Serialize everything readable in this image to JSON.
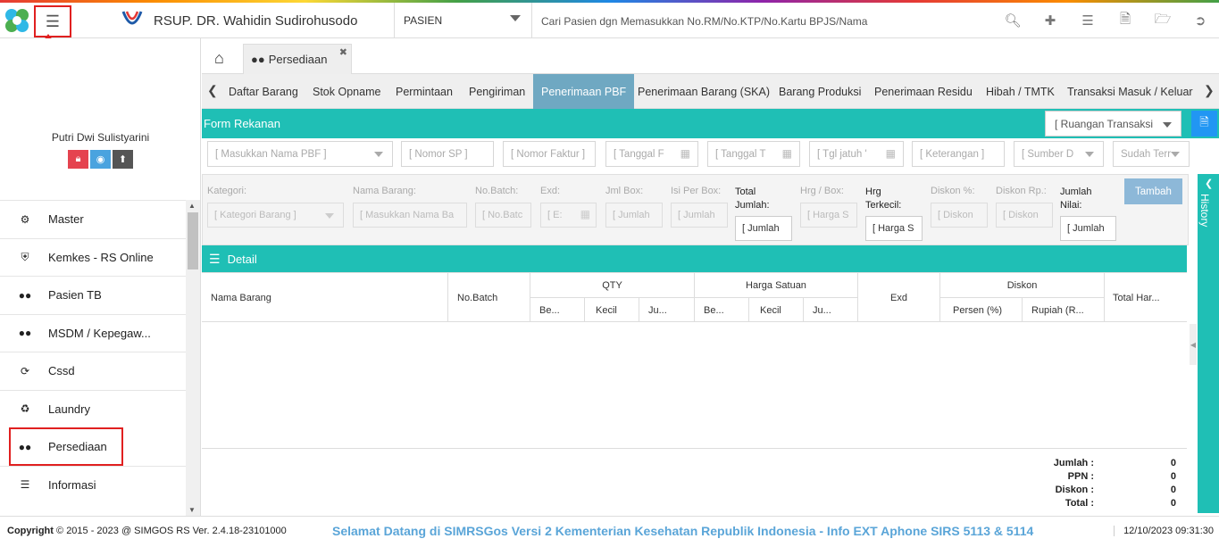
{
  "header": {
    "hospital_name": "RSUP. DR. Wahidin Sudirohusodo",
    "patient_select": "PASIEN",
    "search_placeholder": "Cari Pasien dgn Memasukkan No.RM/No.KTP/No.Kartu BPJS/Nama",
    "icons": [
      "search-icon",
      "add-user-icon",
      "list-icon",
      "pdf-icon",
      "folder-icon",
      "logout-icon"
    ]
  },
  "sidebar": {
    "user_name": "Putri Dwi Sulistyarini",
    "user_button_colors": [
      "#e5434f",
      "#4aa3df",
      "#555555"
    ],
    "items": [
      {
        "label": "Master",
        "icon": "gears-icon"
      },
      {
        "label": "Kemkes - RS Online",
        "icon": "shield-icon"
      },
      {
        "label": "Pasien TB",
        "icon": "users-icon"
      },
      {
        "label": "MSDM / Kepegaw...",
        "icon": "users-icon"
      },
      {
        "label": "Cssd",
        "icon": "refresh-icon"
      },
      {
        "label": "Laundry",
        "icon": "recycle-icon"
      },
      {
        "label": "Persediaan",
        "icon": "users-icon"
      },
      {
        "label": "Informasi",
        "icon": "database-icon"
      }
    ]
  },
  "tabs": {
    "page_tab": "Persediaan",
    "subtabs": [
      "Daftar Barang",
      "Stok Opname",
      "Permintaan",
      "Pengiriman",
      "Penerimaan PBF",
      "Penerimaan Barang (SKA)",
      "Barang Produksi",
      "Penerimaan Residu",
      "Hibah / TMTK",
      "Transaksi Masuk / Keluar"
    ],
    "active_subtab": "Penerimaan PBF"
  },
  "form": {
    "title": "Form Rekanan",
    "ruangan": "[ Ruangan Transaksi",
    "fields": [
      "[ Masukkan Nama PBF ]",
      "[ Nomor SP ]",
      "[ Nomor Faktur ]",
      "[ Tanggal F",
      "[ Tanggal T",
      "[ Tgl jatuh '",
      "[ Keterangan ]",
      "[ Sumber D",
      "Sudah Terr"
    ]
  },
  "item_form": {
    "labels": {
      "kategori": "Kategori:",
      "nama_barang": "Nama Barang:",
      "no_batch": "No.Batch:",
      "exd": "Exd:",
      "jml_box": "Jml Box:",
      "isi_per_box": "Isi Per Box:",
      "total_jumlah": "Total Jumlah:",
      "hrg_box": "Hrg / Box:",
      "hrg_terkecil": "Hrg Terkecil:",
      "diskon_pct": "Diskon %:",
      "diskon_rp": "Diskon Rp.:",
      "jumlah_nilai": "Jumlah Nilai:"
    },
    "placeholders": {
      "kategori": "[ Kategori Barang ]",
      "nama_barang": "[ Masukkan Nama Ba",
      "no_batch": "[ No.Batc",
      "exd": "[ E:",
      "jml_box": "[ Jumlah",
      "isi_per_box": "[ Jumlah",
      "total_jumlah": "[ Jumlah",
      "hrg_box": "[ Harga S",
      "hrg_terkecil": "[ Harga S",
      "diskon_pct": "[ Diskon",
      "diskon_rp": "[ Diskon",
      "jumlah_nilai": "[ Jumlah"
    },
    "add_button": "Tambah"
  },
  "detail": {
    "title": "Detail",
    "columns": {
      "nama_barang": "Nama Barang",
      "no_batch": "No.Batch",
      "qty": "QTY",
      "qty_be": "Be...",
      "qty_kecil": "Kecil",
      "qty_ju": "Ju...",
      "harga_satuan": "Harga Satuan",
      "hs_be": "Be...",
      "hs_kecil": "Kecil",
      "hs_ju": "Ju...",
      "exd": "Exd",
      "diskon": "Diskon",
      "diskon_persen": "Persen (%)",
      "diskon_rupiah": "Rupiah (R...",
      "total_harga": "Total Har..."
    },
    "totals": [
      {
        "label": "Jumlah :",
        "value": "0"
      },
      {
        "label": "PPN :",
        "value": "0"
      },
      {
        "label": "Diskon :",
        "value": "0"
      },
      {
        "label": "Total :",
        "value": "0"
      }
    ]
  },
  "history_label": "History",
  "footer": {
    "copyright": "Copyright",
    "copyright_text": "2015 - 2023 @ SIMGOS RS Ver. 2.4.18-23101000",
    "marquee": "Selamat Datang di SIMRSGos Versi 2 Kementerian Kesehatan Republik Indonesia - Info EXT Aphone SIRS 5113 & 5114",
    "datetime": "12/10/2023 09:31:30"
  }
}
